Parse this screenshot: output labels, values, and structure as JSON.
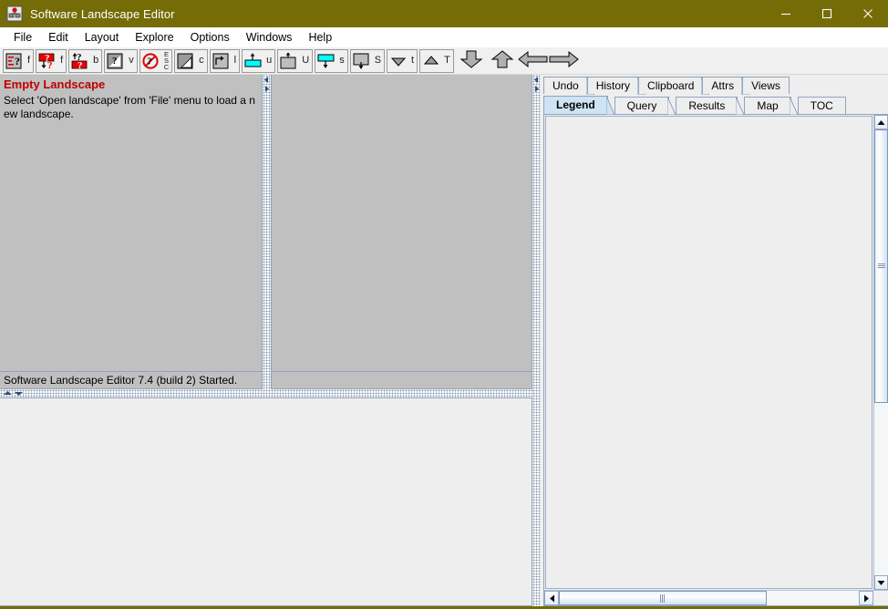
{
  "window": {
    "title": "Software Landscape Editor",
    "icon": "app-icon",
    "minimize_label": "—",
    "maximize_label": "□",
    "close_label": "✕",
    "titlebar_color": "#756b07"
  },
  "menubar": {
    "items": [
      {
        "label": "File"
      },
      {
        "label": "Edit"
      },
      {
        "label": "Layout"
      },
      {
        "label": "Explore"
      },
      {
        "label": "Options"
      },
      {
        "label": "Windows"
      },
      {
        "label": "Help"
      }
    ]
  },
  "toolbar": {
    "buttons": [
      {
        "icon": "find-question-icon",
        "key": "f"
      },
      {
        "icon": "find-down-question-icon",
        "key": "f"
      },
      {
        "icon": "back-question-icon",
        "key": "b"
      },
      {
        "icon": "view-question-icon",
        "key": "v"
      },
      {
        "icon": "escape-no-icon",
        "key": "ESC"
      },
      {
        "icon": "clear-diagonal-icon",
        "key": "c"
      },
      {
        "icon": "link-arrow-icon",
        "key": "l"
      },
      {
        "icon": "up-cyan-bar-icon",
        "key": "u"
      },
      {
        "icon": "up-box-icon",
        "key": "U"
      },
      {
        "icon": "cyan-bar-down-icon",
        "key": "s"
      },
      {
        "icon": "box-down-icon",
        "key": "S"
      },
      {
        "icon": "triangle-down-icon",
        "key": "t"
      },
      {
        "icon": "triangle-up-icon",
        "key": "T"
      },
      {
        "icon": "arrow-down-big-icon",
        "key": ""
      },
      {
        "icon": "arrow-up-big-icon",
        "key": ""
      },
      {
        "icon": "arrow-left-big-icon",
        "key": ""
      },
      {
        "icon": "arrow-right-big-icon",
        "key": ""
      }
    ]
  },
  "left_panel": {
    "heading": "Empty Landscape",
    "body": "Select 'Open landscape' from 'File' menu to load a new landscape.",
    "status": "Software Landscape Editor 7.4 (build 2) Started."
  },
  "right_panel": {
    "tabs_row1": [
      {
        "label": "Undo",
        "selected": false
      },
      {
        "label": "History",
        "selected": false
      },
      {
        "label": "Clipboard",
        "selected": false
      },
      {
        "label": "Attrs",
        "selected": false
      },
      {
        "label": "Views",
        "selected": false
      }
    ],
    "tabs_row2": [
      {
        "label": "Legend",
        "selected": true
      },
      {
        "label": "Query",
        "selected": false
      },
      {
        "label": "Results",
        "selected": false
      },
      {
        "label": "Map",
        "selected": false
      },
      {
        "label": "TOC",
        "selected": false
      }
    ],
    "content": ""
  },
  "colors": {
    "accent": "#756b07",
    "panel_gray": "#c0c0c0",
    "heading_red": "#c00000",
    "tab_selected": "#cfe3f5",
    "border_blue": "#8fa4bd",
    "cyan": "#00ffff",
    "icon_red": "#ee0000"
  }
}
